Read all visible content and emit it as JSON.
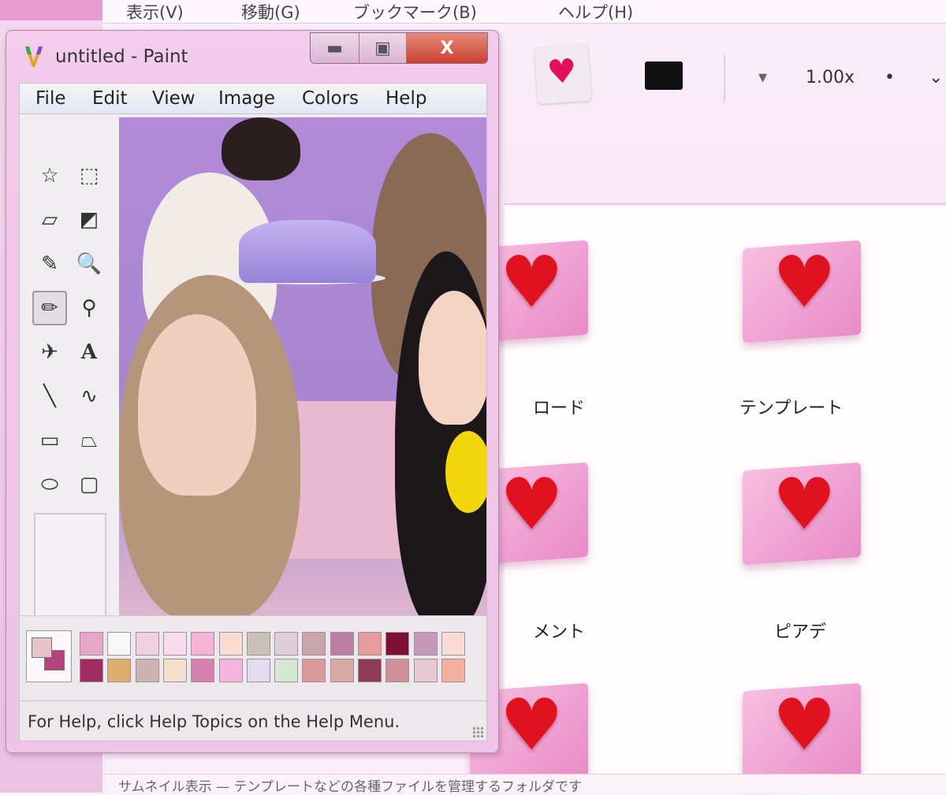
{
  "background_window": {
    "menubar": [
      "表示(V)",
      "移動(G)",
      "ブックマーク(B)",
      "ヘルプ(H)"
    ],
    "toolbar": {
      "size_label": "1.00x",
      "dot": "•",
      "chevron": "⌄"
    },
    "folders": [
      {
        "label": "ロード"
      },
      {
        "label": "テンプレート"
      },
      {
        "label": "メント"
      },
      {
        "label": "ピアデ"
      },
      {
        "label": ""
      },
      {
        "label": ""
      }
    ],
    "status_text": "サムネイル表示 — テンプレートなどの各種ファイルを管理するフォルダです"
  },
  "paint": {
    "title": "untitled - Paint",
    "window_buttons": {
      "minimize": "▬",
      "maximize": "▣",
      "close": "X"
    },
    "menu": [
      "File",
      "Edit",
      "View",
      "Image",
      "Colors",
      "Help"
    ],
    "tools": [
      {
        "name": "free-form-select",
        "glyph": "☆"
      },
      {
        "name": "rect-select",
        "glyph": "⬚"
      },
      {
        "name": "eraser",
        "glyph": "▱"
      },
      {
        "name": "fill",
        "glyph": "◩"
      },
      {
        "name": "pick-color",
        "glyph": "✎"
      },
      {
        "name": "magnifier",
        "glyph": "🔍"
      },
      {
        "name": "pencil",
        "glyph": "✏"
      },
      {
        "name": "brush",
        "glyph": "⚲"
      },
      {
        "name": "airbrush",
        "glyph": "✈"
      },
      {
        "name": "text",
        "glyph": "A"
      },
      {
        "name": "line",
        "glyph": "╲"
      },
      {
        "name": "curve",
        "glyph": "∿"
      },
      {
        "name": "rectangle",
        "glyph": "▭"
      },
      {
        "name": "polygon",
        "glyph": "⏢"
      },
      {
        "name": "ellipse",
        "glyph": "⬭"
      },
      {
        "name": "rounded-rectangle",
        "glyph": "▢"
      }
    ],
    "active_tool": "pencil",
    "colors": {
      "foreground": "#e5c3c6",
      "background": "#b2437d",
      "palette_row1": [
        "#e7a5c8",
        "#f8f8f8",
        "#f1cfe3",
        "#fbdcef",
        "#f6b4d4",
        "#fbdcd1",
        "#c8c1b4",
        "#e0cfdb",
        "#c9a4a8",
        "#bd7ea6",
        "#e79b9d",
        "#7e1035",
        "#c49ab8",
        "#f9dcd5"
      ],
      "palette_row2": [
        "#9d2c63",
        "#dcad6c",
        "#cdb4b4",
        "#f4dfcc",
        "#d77fb1",
        "#f6b5dd",
        "#e2def0",
        "#d6e7d2",
        "#d99a9c",
        "#d9a9a8",
        "#8d3a55",
        "#cf8f9b",
        "#e4cacf",
        "#f5b09d"
      ]
    },
    "status_text": "For Help, click Help Topics on the Help Menu."
  }
}
